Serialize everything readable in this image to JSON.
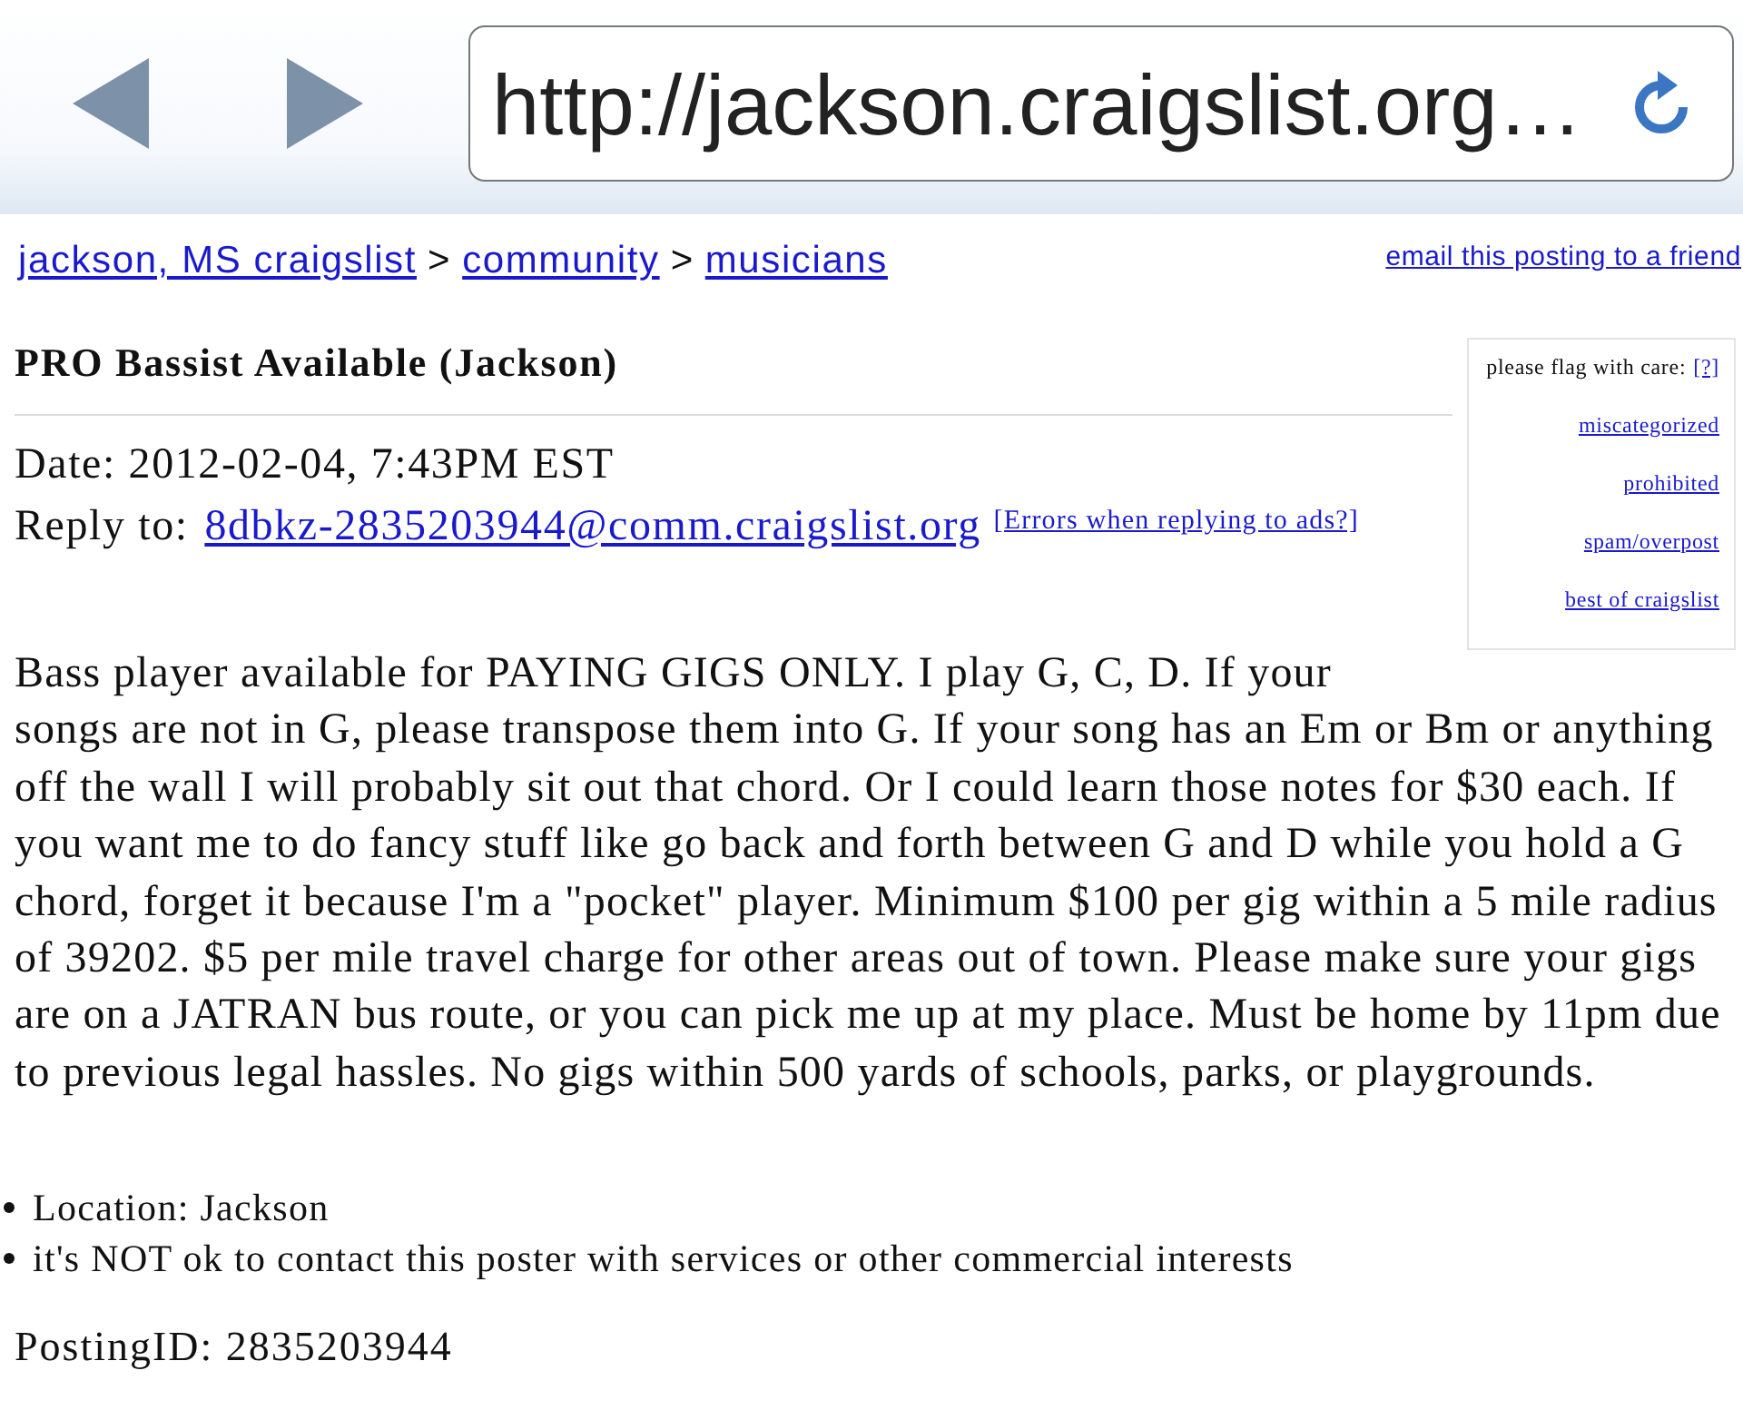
{
  "toolbar": {
    "url": "http://jackson.craigslist.org…"
  },
  "breadcrumb": {
    "links": [
      "jackson, MS craigslist",
      "community",
      "musicians"
    ],
    "separators": [
      ">",
      ">"
    ]
  },
  "email_link": "email this posting to a friend",
  "flag_box": {
    "label": "please flag with care:",
    "help_link": "[?]",
    "links": [
      "miscategorized",
      "prohibited",
      "spam/overpost",
      "best of craigslist"
    ]
  },
  "title": "PRO Bassist Available (Jackson)",
  "date": "Date: 2012-02-04, 7:43PM EST",
  "reply": {
    "label": "Reply to:",
    "email": "8dbkz-2835203944@comm.craigslist.org",
    "help_link": "[Errors when replying to ads?]"
  },
  "body": "Bass player available for PAYING GIGS ONLY. I play G, C, D. If your songs are not in G, please transpose them into G. If your song has an Em or Bm or anything off the wall I will probably sit out that chord. Or I could learn those notes for $30 each. If you want me to do fancy stuff like go back and forth between G and D while you hold a G chord, forget it because I'm a \"pocket\" player. Minimum $100 per gig within a 5 mile radius of 39202. $5 per mile travel charge for other areas out of town. Please make sure your gigs are on a JATRAN bus route, or you can pick me up at my place. Must be home by 11pm due to previous legal hassles. No gigs within 500 yards of schools, parks, or playgrounds.",
  "details": [
    "Location: Jackson",
    "it's NOT ok to contact this poster with services or other commercial interests"
  ],
  "posting_id": "PostingID: 2835203944"
}
